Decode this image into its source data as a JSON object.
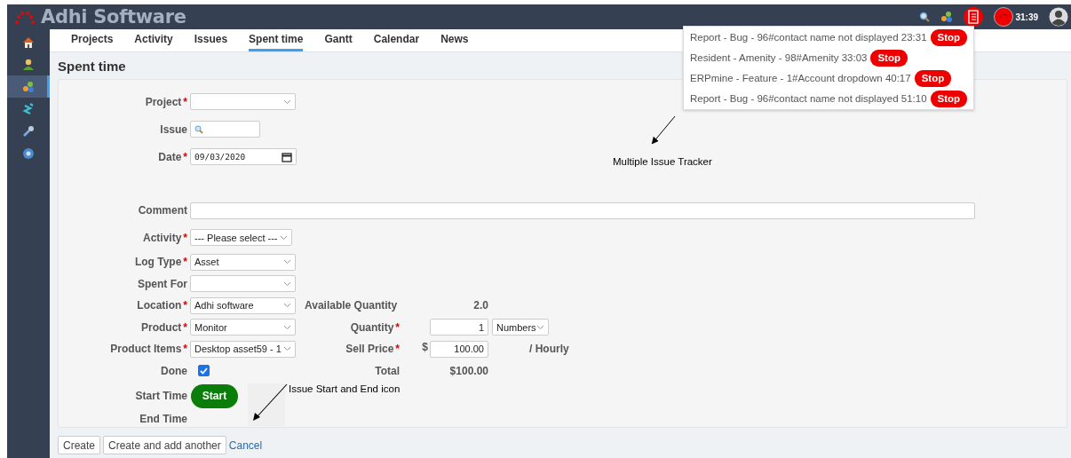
{
  "header": {
    "title": "Adhi Software",
    "timer": "31:39"
  },
  "sidebar": {
    "items": [
      {
        "kind": "home",
        "selected": false
      },
      {
        "kind": "user",
        "selected": false
      },
      {
        "kind": "dots",
        "selected": true
      },
      {
        "kind": "stack",
        "selected": false
      },
      {
        "kind": "wrench",
        "selected": false
      },
      {
        "kind": "help",
        "selected": false
      }
    ]
  },
  "tabs": [
    {
      "label": "Projects",
      "selected": false
    },
    {
      "label": "Activity",
      "selected": false
    },
    {
      "label": "Issues",
      "selected": false
    },
    {
      "label": "Spent time",
      "selected": true
    },
    {
      "label": "Gantt",
      "selected": false
    },
    {
      "label": "Calendar",
      "selected": false
    },
    {
      "label": "News",
      "selected": false
    }
  ],
  "page_title": "Spent time",
  "form": {
    "required_mark": "*",
    "rows": [
      {
        "label": "Project",
        "required": true,
        "kind": "select",
        "value": ""
      },
      {
        "label": "Issue",
        "required": false,
        "kind": "search",
        "value": ""
      },
      {
        "label": "Date",
        "required": true,
        "kind": "date",
        "value": "09/03/2020"
      },
      {
        "kind": "spacer"
      },
      {
        "label": "Comment",
        "required": false,
        "kind": "text",
        "value": ""
      },
      {
        "label": "Activity",
        "required": true,
        "kind": "select",
        "value": "--- Please select ---"
      },
      {
        "label": "Log Type",
        "required": true,
        "kind": "select",
        "value": "Asset"
      },
      {
        "label": "Spent For",
        "required": false,
        "kind": "select",
        "value": ""
      },
      {
        "label": "Location",
        "required": true,
        "kind": "select",
        "value": "Adhi software",
        "extra": {
          "kind": "reading",
          "label": "Available Quantity",
          "required": false,
          "value": "2.0"
        }
      },
      {
        "label": "Product",
        "required": true,
        "kind": "select",
        "value": "Monitor",
        "extra": {
          "kind": "quantity",
          "label": "Quantity",
          "required": true,
          "value": "1",
          "unit": "Numbers"
        }
      },
      {
        "label": "Product Items",
        "required": true,
        "kind": "select",
        "value": "Desktop asset59 - 1",
        "extra": {
          "kind": "price",
          "label": "Sell Price",
          "required": true,
          "currency": "$",
          "value": "100.00",
          "suffix": "/ Hourly"
        }
      },
      {
        "label": "Done",
        "required": false,
        "kind": "checkbox",
        "checked": true,
        "extra": {
          "kind": "reading",
          "label": "Total",
          "required": false,
          "value": "$100.00"
        }
      },
      {
        "label": "Start Time",
        "required": false,
        "kind": "button",
        "value": "Start"
      },
      {
        "label": "End Time",
        "required": false,
        "kind": "empty"
      }
    ]
  },
  "actions": [
    {
      "kind": "button",
      "label": "Create"
    },
    {
      "kind": "button",
      "label": "Create and add another"
    },
    {
      "kind": "link",
      "label": "Cancel"
    }
  ],
  "timers": [
    {
      "text": "Report - Bug - 96#contact name not displayed 23:31",
      "button": "Stop"
    },
    {
      "text": "Resident - Amenity - 98#Amenity 33:03",
      "button": "Stop"
    },
    {
      "text": "ERPmine - Feature - 1#Account dropdown 40:17",
      "button": "Stop"
    },
    {
      "text": "Report - Bug - 96#contact name not displayed 51:10",
      "button": "Stop"
    }
  ],
  "annotations": [
    {
      "text": "Multiple Issue Tracker"
    },
    {
      "text": "Issue Start and End icon"
    }
  ]
}
